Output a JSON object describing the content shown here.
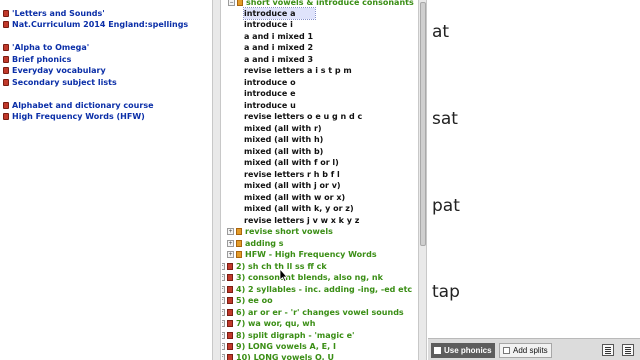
{
  "courses": [
    {
      "label": "'Letters and Sounds'"
    },
    {
      "label": "Nat.Curriculum 2014 England:spellings"
    },
    {
      "label": "'Alpha to Omega'"
    },
    {
      "label": "Brief phonics"
    },
    {
      "label": "Everyday vocabulary"
    },
    {
      "label": "Secondary subject lists"
    },
    {
      "label": "Alphabet and dictionary course"
    },
    {
      "label": "High Frequency Words (HFW)"
    }
  ],
  "tree": {
    "header": "short vowels & introduce consonants",
    "lessons": [
      "introduce a",
      "introduce i",
      "a and i mixed 1",
      "a and i mixed 2",
      "a and i mixed 3",
      "revise letters a i s t p m",
      "introduce o",
      "introduce e",
      "introduce u",
      "revise letters o e u g n d c",
      "mixed (all with r)",
      "mixed (all with h)",
      "mixed (all with b)",
      "mixed (all with f or l)",
      "revise letters r h b f  l",
      "mixed (all with j or v)",
      "mixed (all with w or x)",
      "mixed (all with k, y or z)",
      "revise letters j v w x k y z"
    ],
    "subsections": [
      "revise short vowels",
      "adding s",
      "HFW - High Frequency Words"
    ],
    "topics": [
      "2)  sh ch th  ll ss ff ck",
      "3)  consonant blends, also ng, nk",
      "4)  2 syllables - inc. adding -ing, -ed  etc",
      "5) ee oo",
      "6)  ar or er - 'r' changes vowel sounds",
      "7)  wa  wor, qu, wh",
      "8)  split digraph - 'magic e'",
      "9)  LONG vowels  A, E, I",
      "10) LONG vowels  O, U"
    ]
  },
  "words": [
    "at",
    "sat",
    "pat",
    "tap"
  ],
  "bottom_bar": {
    "use_phonics": "Use phonics",
    "add_splits": "Add splits",
    "list_icon_1": "list-icon",
    "list_icon_2": "list-icon"
  },
  "colors": {
    "course_link": "#0b2fa8",
    "section_green": "#3a8e15",
    "lesson_black": "#111111",
    "selected_bg": "#dfe3fb"
  }
}
